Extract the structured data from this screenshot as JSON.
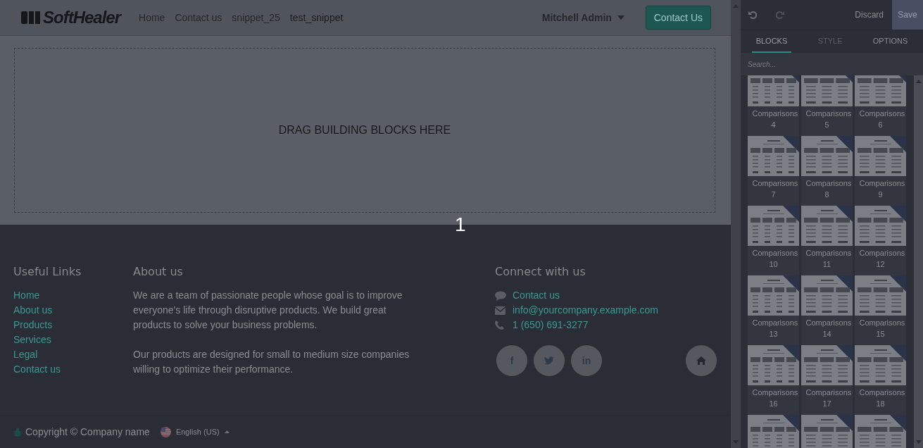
{
  "header": {
    "logo": "SoftHealer",
    "nav": [
      {
        "label": "Home",
        "selected": false
      },
      {
        "label": "Contact us",
        "selected": false
      },
      {
        "label": "snippet_25",
        "selected": false
      },
      {
        "label": "test_snippet",
        "selected": true
      }
    ],
    "user": "Mitchell Admin",
    "cta": "Contact Us"
  },
  "drop_zone": {
    "text": "DRAG BUILDING BLOCKS HERE"
  },
  "step_marker": "1",
  "footer": {
    "useful_links": {
      "title": "Useful Links",
      "links": [
        "Home",
        "About us",
        "Products",
        "Services",
        "Legal",
        "Contact us"
      ]
    },
    "about": {
      "title": "About us",
      "paragraphs": [
        "We are a team of passionate people whose goal is to improve everyone's life through disruptive products. We build great products to solve your business problems.",
        "Our products are designed for small to medium size companies willing to optimize their performance."
      ]
    },
    "connect": {
      "title": "Connect with us",
      "items": [
        {
          "kind": "chat",
          "text": "Contact us"
        },
        {
          "kind": "mail",
          "text": "info@yourcompany.example.com"
        },
        {
          "kind": "phone",
          "text": "1 (650) 691-3277"
        }
      ],
      "social": [
        {
          "kind": "facebook",
          "label": "f"
        },
        {
          "kind": "twitter"
        },
        {
          "kind": "linkedin",
          "label": "in"
        },
        {
          "kind": "home"
        }
      ]
    },
    "copyright": "Copyright © Company name",
    "language": "English (US)"
  },
  "editor": {
    "discard": "Discard",
    "save": "Save",
    "tabs": [
      {
        "label": "BLOCKS",
        "selected": true,
        "disabled": false
      },
      {
        "label": "STYLE",
        "selected": false,
        "disabled": true
      },
      {
        "label": "OPTIONS",
        "selected": false,
        "disabled": false
      }
    ],
    "search": {
      "placeholder": "Search..."
    },
    "blocks": [
      {
        "kind": "block",
        "label": "Comparisons 4"
      },
      {
        "kind": "block",
        "label": "Comparisons 5"
      },
      {
        "kind": "block",
        "label": "Comparisons 6"
      },
      {
        "kind": "block",
        "label": "Comparisons 7"
      },
      {
        "kind": "block",
        "label": "Comparisons 8"
      },
      {
        "kind": "block",
        "label": "Comparisons 9"
      },
      {
        "kind": "block",
        "label": "Comparisons 10"
      },
      {
        "kind": "block",
        "label": "Comparisons 11"
      },
      {
        "kind": "block",
        "label": "Comparisons 12"
      },
      {
        "kind": "block",
        "label": "Comparisons 13"
      },
      {
        "kind": "block",
        "label": "Comparisons 14"
      },
      {
        "kind": "block",
        "label": "Comparisons 15"
      },
      {
        "kind": "block",
        "label": "Comparisons 16"
      },
      {
        "kind": "block",
        "label": "Comparisons 17"
      },
      {
        "kind": "block",
        "label": "Comparisons 18"
      },
      {
        "kind": "preview"
      },
      {
        "kind": "preview"
      },
      {
        "kind": "preview"
      }
    ]
  }
}
